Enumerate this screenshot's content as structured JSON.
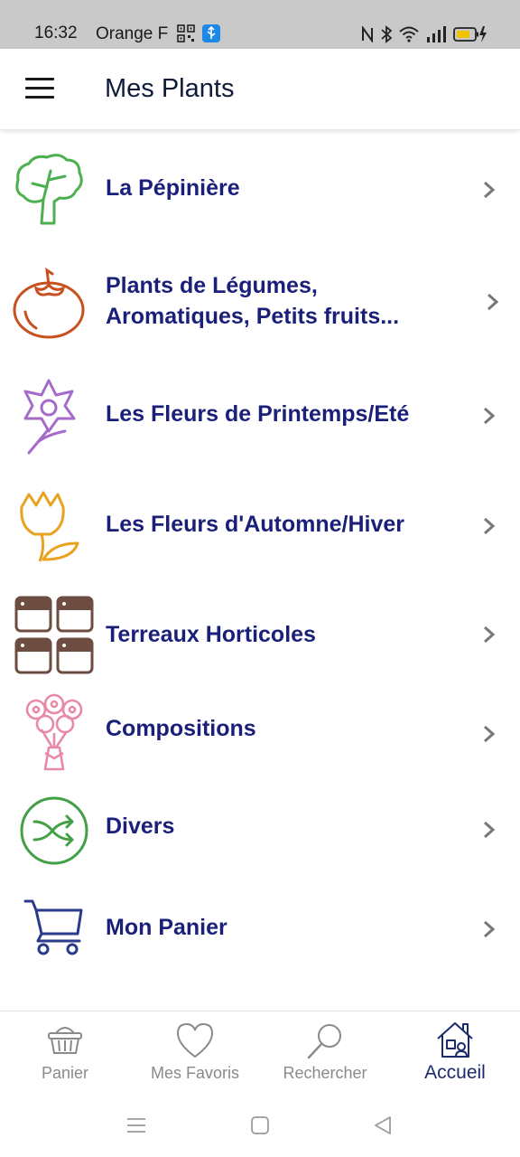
{
  "status_bar": {
    "time": "16:32",
    "carrier": "Orange F"
  },
  "app_bar": {
    "title": "Mes Plants",
    "menu_icon": "hamburger-icon"
  },
  "menu_items": [
    {
      "label": "La Pépinière",
      "icon": "tree-icon",
      "color": "#4caf50"
    },
    {
      "label": "Plants de Légumes,\nAromatiques, Petits fruits...",
      "icon": "tomato-icon",
      "color": "#c8501e"
    },
    {
      "label": "Les Fleurs de Printemps/Eté",
      "icon": "flower-icon",
      "color": "#a56bc9"
    },
    {
      "label": "Les Fleurs d'Automne/Hiver",
      "icon": "tulip-icon",
      "color": "#e8a320"
    },
    {
      "label": "Terreaux Horticoles",
      "icon": "soil-bags-icon",
      "color": "#6d4c41"
    },
    {
      "label": "Compositions",
      "icon": "bouquet-icon",
      "color": "#e88aa6"
    },
    {
      "label": "Divers",
      "icon": "shuffle-icon",
      "color": "#43a047"
    },
    {
      "label": "Mon Panier",
      "icon": "cart-icon",
      "color": "#2a3a8c"
    }
  ],
  "bottom_nav": [
    {
      "label": "Panier",
      "icon": "basket-icon",
      "active": false
    },
    {
      "label": "Mes Favoris",
      "icon": "heart-icon",
      "active": false
    },
    {
      "label": "Rechercher",
      "icon": "search-icon",
      "active": false
    },
    {
      "label": "Accueil",
      "icon": "home-icon",
      "active": true
    }
  ],
  "colors": {
    "label": "#1a1f7a",
    "active_nav": "#1a2a6c",
    "inactive_nav": "#8a8a8a",
    "status_bar": "#c9c9c9"
  }
}
